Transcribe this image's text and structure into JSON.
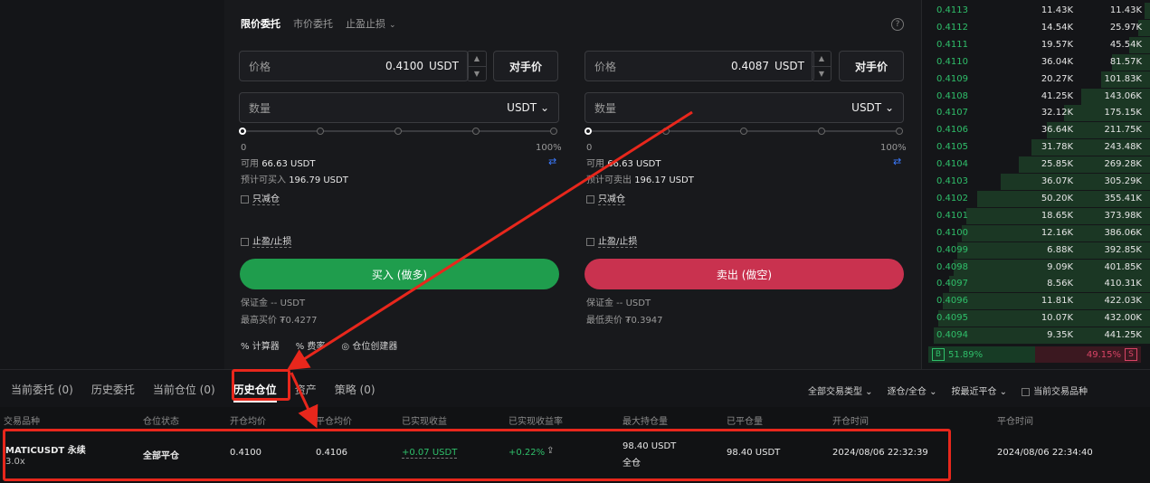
{
  "order_tabs": {
    "limit": "限价委托",
    "market": "市价委托",
    "tpsl": "止盈止损",
    "chevron": "⌄"
  },
  "info_icon": "?",
  "buy": {
    "price_label": "价格",
    "price_value": "0.4100",
    "price_unit": "USDT",
    "counterparty_btn": "对手价",
    "qty_label": "数量",
    "qty_unit": "USDT ⌄",
    "pct_min": "0",
    "pct_max": "100%",
    "available_label": "可用",
    "available_value": "66.63 USDT",
    "est_label": "预计可买入",
    "est_value": "196.79 USDT",
    "reduce_only": "只减仓",
    "tpsl": "止盈/止损",
    "action": "买入 (做多)",
    "margin": "保证金 -- USDT",
    "best": "最高买价 ₮0.4277"
  },
  "sell": {
    "price_label": "价格",
    "price_value": "0.4087",
    "price_unit": "USDT",
    "counterparty_btn": "对手价",
    "qty_label": "数量",
    "qty_unit": "USDT ⌄",
    "pct_min": "0",
    "pct_max": "100%",
    "available_label": "可用",
    "available_value": "66.63 USDT",
    "est_label": "预计可卖出",
    "est_value": "196.17 USDT",
    "reduce_only": "只减仓",
    "tpsl": "止盈/止损",
    "action": "卖出 (做空)",
    "margin": "保证金 -- USDT",
    "best": "最低卖价 ₮0.3947"
  },
  "tools": {
    "calculator": "计算器",
    "fee": "费率",
    "position_builder": "仓位创建器"
  },
  "orderbook": {
    "rows": [
      {
        "price": "0.4113",
        "qty": "11.43K",
        "total": "11.43K",
        "depth": 0.03
      },
      {
        "price": "0.4112",
        "qty": "14.54K",
        "total": "25.97K",
        "depth": 0.06
      },
      {
        "price": "0.4111",
        "qty": "19.57K",
        "total": "45.54K",
        "depth": 0.1
      },
      {
        "price": "0.4110",
        "qty": "36.04K",
        "total": "81.57K",
        "depth": 0.18
      },
      {
        "price": "0.4109",
        "qty": "20.27K",
        "total": "101.83K",
        "depth": 0.23
      },
      {
        "price": "0.4108",
        "qty": "41.25K",
        "total": "143.06K",
        "depth": 0.32
      },
      {
        "price": "0.4107",
        "qty": "32.12K",
        "total": "175.15K",
        "depth": 0.4
      },
      {
        "price": "0.4106",
        "qty": "36.64K",
        "total": "211.75K",
        "depth": 0.48
      },
      {
        "price": "0.4105",
        "qty": "31.78K",
        "total": "243.48K",
        "depth": 0.55
      },
      {
        "price": "0.4104",
        "qty": "25.85K",
        "total": "269.28K",
        "depth": 0.61
      },
      {
        "price": "0.4103",
        "qty": "36.07K",
        "total": "305.29K",
        "depth": 0.69
      },
      {
        "price": "0.4102",
        "qty": "50.20K",
        "total": "355.41K",
        "depth": 0.8
      },
      {
        "price": "0.4101",
        "qty": "18.65K",
        "total": "373.98K",
        "depth": 0.85
      },
      {
        "price": "0.4100",
        "qty": "12.16K",
        "total": "386.06K",
        "depth": 0.87
      },
      {
        "price": "0.4099",
        "qty": "6.88K",
        "total": "392.85K",
        "depth": 0.89
      },
      {
        "price": "0.4098",
        "qty": "9.09K",
        "total": "401.85K",
        "depth": 0.91
      },
      {
        "price": "0.4097",
        "qty": "8.56K",
        "total": "410.31K",
        "depth": 0.93
      },
      {
        "price": "0.4096",
        "qty": "11.81K",
        "total": "422.03K",
        "depth": 0.96
      },
      {
        "price": "0.4095",
        "qty": "10.07K",
        "total": "432.00K",
        "depth": 0.98
      },
      {
        "price": "0.4094",
        "qty": "9.35K",
        "total": "441.25K",
        "depth": 1.0
      }
    ],
    "buy_tag": "B",
    "buy_ratio": "51.89%",
    "sell_tag": "S",
    "sell_ratio": "49.15%"
  },
  "bottom_tabs": [
    {
      "label": "当前委托 (0)"
    },
    {
      "label": "历史委托"
    },
    {
      "label": "当前仓位 (0)"
    },
    {
      "label": "历史仓位"
    },
    {
      "label": "资产"
    },
    {
      "label": "策略 (0)"
    }
  ],
  "filters": {
    "trade_type": "全部交易类型 ⌄",
    "margin_mode": "逐仓/全仓 ⌄",
    "sort": "按最近平仓 ⌄",
    "current_symbol": "当前交易品种"
  },
  "table": {
    "headers": [
      "交易品种",
      "仓位状态",
      "开仓均价",
      "平仓均价",
      "已实现收益",
      "已实现收益率",
      "最大持仓量",
      "已平仓量",
      "开仓时间",
      "平仓时间"
    ],
    "row": {
      "symbol": "MATICUSDT 永续",
      "leverage": "3.0x",
      "status": "全部平仓",
      "open_avg": "0.4100",
      "close_avg": "0.4106",
      "pnl": "+0.07 USDT",
      "pnl_rate": "+0.22%",
      "max_pos": "98.40 USDT",
      "max_pos_mode": "全仓",
      "closed_qty": "98.40 USDT",
      "open_time": "2024/08/06 22:32:39",
      "close_time": "2024/08/06 22:34:40"
    }
  },
  "colors": {
    "buy": "#1f9d4d",
    "sell": "#c9324f",
    "annotation": "#e8271c"
  }
}
